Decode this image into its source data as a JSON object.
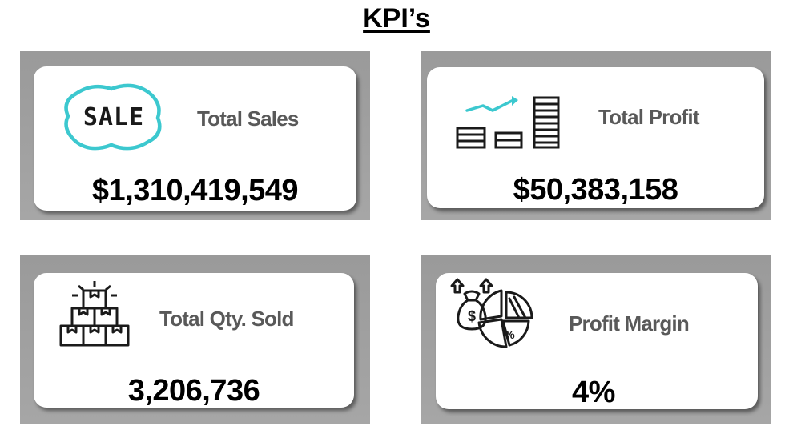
{
  "page": {
    "title": "KPI’s"
  },
  "colors": {
    "tile_gray": "#a2a2a2",
    "card_white": "#ffffff",
    "label_gray": "#595959",
    "value_black": "#000000",
    "sale_teal": "#3cc8cf"
  },
  "kpis": {
    "total_sales": {
      "label": "Total Sales",
      "value": "$1,310,419,549",
      "icon": "sale-tag-icon",
      "icon_text": "SALE"
    },
    "total_profit": {
      "label": "Total Profit",
      "value": "$50,383,158",
      "icon": "profit-growth-icon"
    },
    "total_qty_sold": {
      "label": "Total Qty. Sold",
      "value": "3,206,736",
      "icon": "stacked-boxes-icon"
    },
    "profit_margin": {
      "label": "Profit Margin",
      "value": "4%",
      "icon": "money-bag-pie-icon",
      "icon_dollar": "$",
      "icon_percent": "%"
    }
  }
}
